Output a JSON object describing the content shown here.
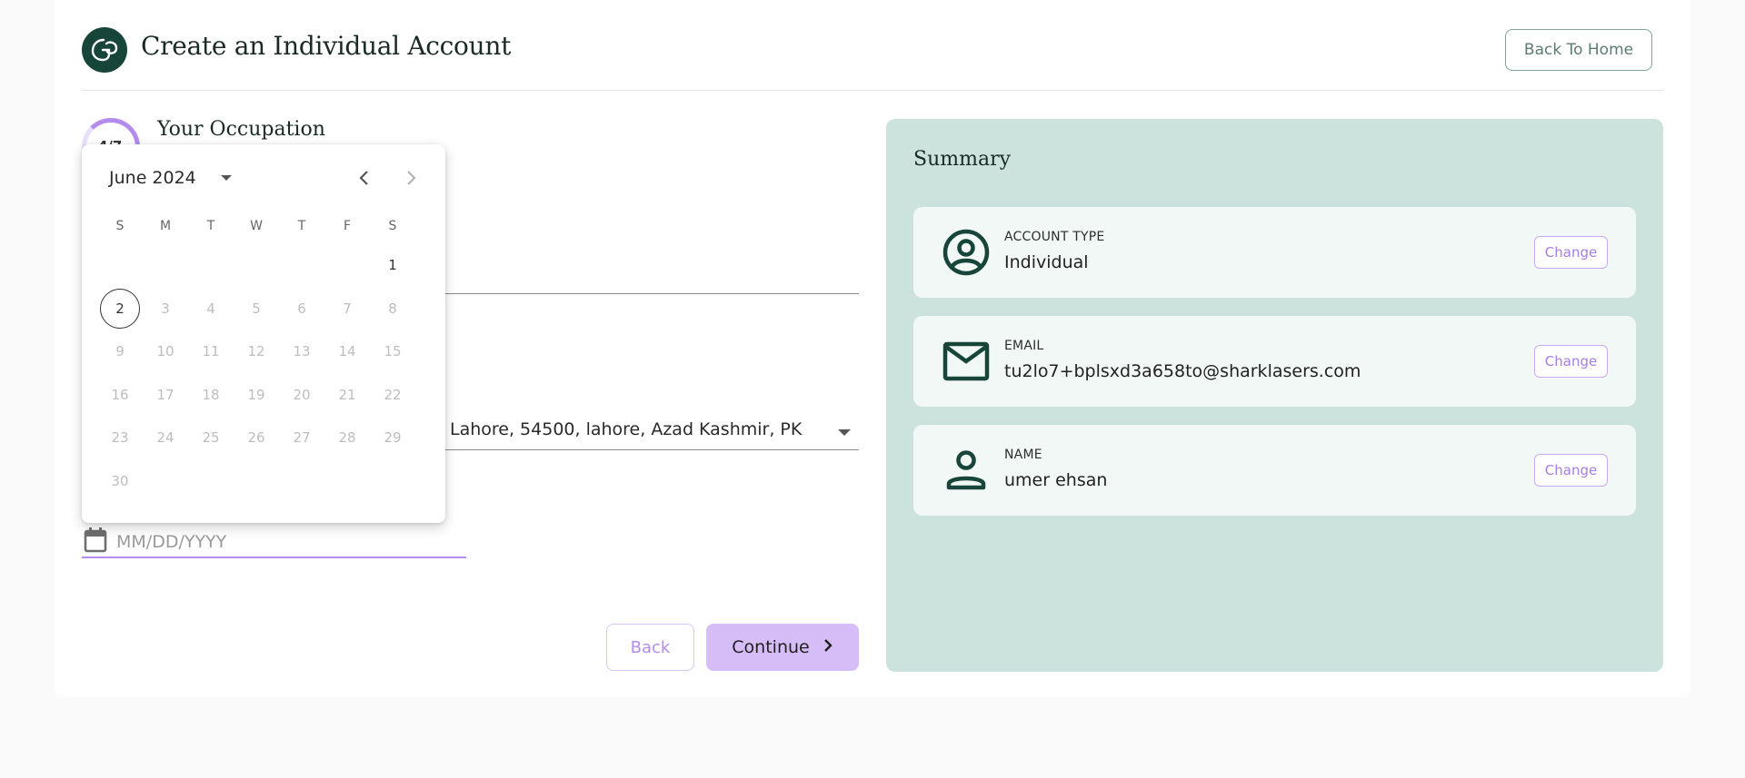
{
  "header": {
    "title": "Create an Individual Account",
    "back_home_label": "Back To Home",
    "logo_icon": "brand-logo-icon"
  },
  "form": {
    "step_text": "4/7",
    "section_title": "Your Occupation",
    "address_value": "Lahore, 54500, lahore, Azad Kashmir, PK",
    "date_placeholder": "MM/DD/YYYY",
    "back_label": "Back",
    "continue_label": "Continue"
  },
  "datepicker": {
    "month_label": "June 2024",
    "weekdays": [
      "S",
      "M",
      "T",
      "W",
      "T",
      "F",
      "S"
    ],
    "days": [
      "1",
      "2",
      "3",
      "4",
      "5",
      "6",
      "7",
      "8",
      "9",
      "10",
      "11",
      "12",
      "13",
      "14",
      "15",
      "16",
      "17",
      "18",
      "19",
      "20",
      "21",
      "22",
      "23",
      "24",
      "25",
      "26",
      "27",
      "28",
      "29",
      "30"
    ],
    "today": "2",
    "enabled_days": [
      "1",
      "2"
    ]
  },
  "summary": {
    "title": "Summary",
    "items": [
      {
        "label": "ACCOUNT TYPE",
        "value": "Individual",
        "change_label": "Change",
        "icon": "account-circle-icon"
      },
      {
        "label": "EMAIL",
        "value": "tu2lo7+bplsxd3a658to@sharklasers.com",
        "change_label": "Change",
        "icon": "email-icon"
      },
      {
        "label": "NAME",
        "value": "umer ehsan",
        "change_label": "Change",
        "icon": "person-icon"
      }
    ]
  },
  "colors": {
    "brand": "#17453a",
    "accent": "#b48ced",
    "summary_bg": "#cce2dc"
  }
}
